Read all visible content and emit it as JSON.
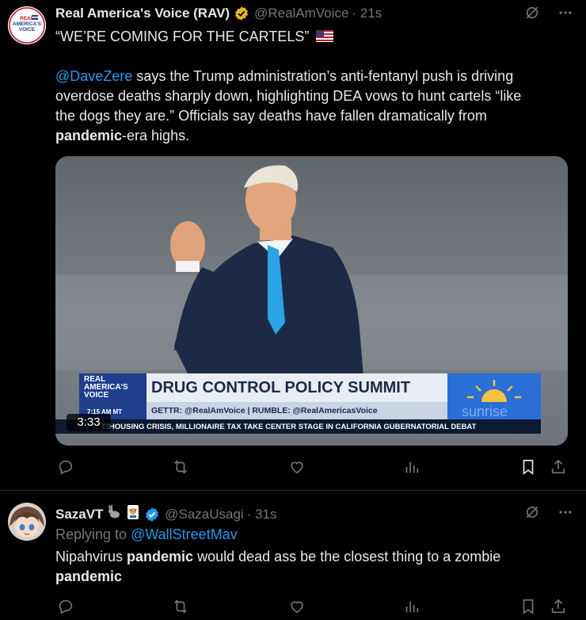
{
  "tweets": [
    {
      "author_name": "Real America's Voice (RAV)",
      "handle": "@RealAmVoice",
      "time": "· 21s",
      "title_line": "“WE’RE COMING FOR THE CARTELS”",
      "mention": "@DaveZere",
      "text_1": " says the Trump administration’s anti-fentanyl push is driving",
      "text_2": "overdose deaths sharply down, highlighting DEA vows to hunt cartels “like",
      "text_3": "the dogs they are.” Officials say deaths have fallen dramatically from",
      "text_4_bold": "pandemic",
      "text_4_rest": "-era highs.",
      "avatar_lines": [
        "REAL",
        "AMERICA'S",
        "VOICE"
      ],
      "video": {
        "duration": "3:33",
        "chyron_logo": [
          "REAL",
          "AMERICA'S",
          "VOICE"
        ],
        "chyron_title": "DRUG CONTROL POLICY SUMMIT",
        "chyron_sub": "GETTR: @RealAmVoice  |  RUMBLE: @RealAmericasVoice",
        "chyron_time": "7:15 AM MT",
        "ticker": "HOUSING CRISIS, MILLIONAIRE TAX TAKE CENTER STAGE IN CALIFORNIA GUBERNATORIAL DEBAT",
        "ticker_prefix": "TS",
        "sunrise": "sunrise"
      }
    },
    {
      "author_name": "SazaVT",
      "name_emojis": "🐇🃏",
      "handle": "@SazaUsagi",
      "time": "· 31s",
      "replying_to_label": "Replying to ",
      "replying_to_handle": "@WallStreetMav",
      "line1_pre": "Nipahvirus ",
      "line1_bold": "pandemic",
      "line1_post": " would dead ass be the closest thing to a zombie",
      "line2_bold": "pandemic"
    }
  ],
  "colors": {
    "background": "#000000",
    "text": "#e7e9ea",
    "muted": "#71767b",
    "link": "#1d9bf0",
    "gold_badge": "#e2b719",
    "blue_badge": "#1d9bf0"
  },
  "icons": [
    "grok-icon",
    "more-icon",
    "reply-icon",
    "repost-icon",
    "like-icon",
    "views-icon",
    "bookmark-icon",
    "share-icon"
  ]
}
